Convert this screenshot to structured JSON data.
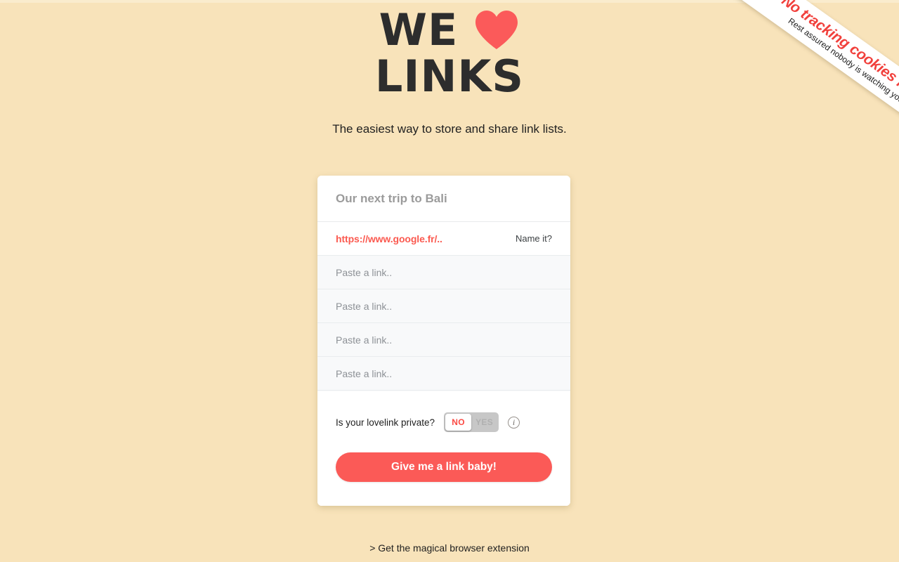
{
  "theme": {
    "background": "#f8e3ba",
    "accent": "#fb5a57",
    "heart": "#fb5a5a",
    "ribbon_title_color": "#f1403c"
  },
  "ribbon": {
    "title": "No tracking cookies here.",
    "subtitle": "Rest assured nobody is watching you!"
  },
  "logo": {
    "word_one": "WE",
    "heart_icon": "heart-icon",
    "word_two": "LINKS"
  },
  "subtitle": "The easiest way to store and share link lists.",
  "card": {
    "title_placeholder": "Our next trip to Bali",
    "rows": [
      {
        "value": "https://www.google.fr/..",
        "action": "Name it?",
        "filled": true
      },
      {
        "value": "Paste a link..",
        "action": "",
        "filled": false
      },
      {
        "value": "Paste a link..",
        "action": "",
        "filled": false
      },
      {
        "value": "Paste a link..",
        "action": "",
        "filled": false
      },
      {
        "value": "Paste a link..",
        "action": "",
        "filled": false
      }
    ],
    "privacy": {
      "label": "Is your lovelink private?",
      "option_no": "NO",
      "option_yes": "YES",
      "selected": "NO",
      "info_icon": "info-icon",
      "info_glyph": "i"
    },
    "submit_label": "Give me a link baby!"
  },
  "footer": {
    "extension_link": "> Get the magical browser extension"
  }
}
